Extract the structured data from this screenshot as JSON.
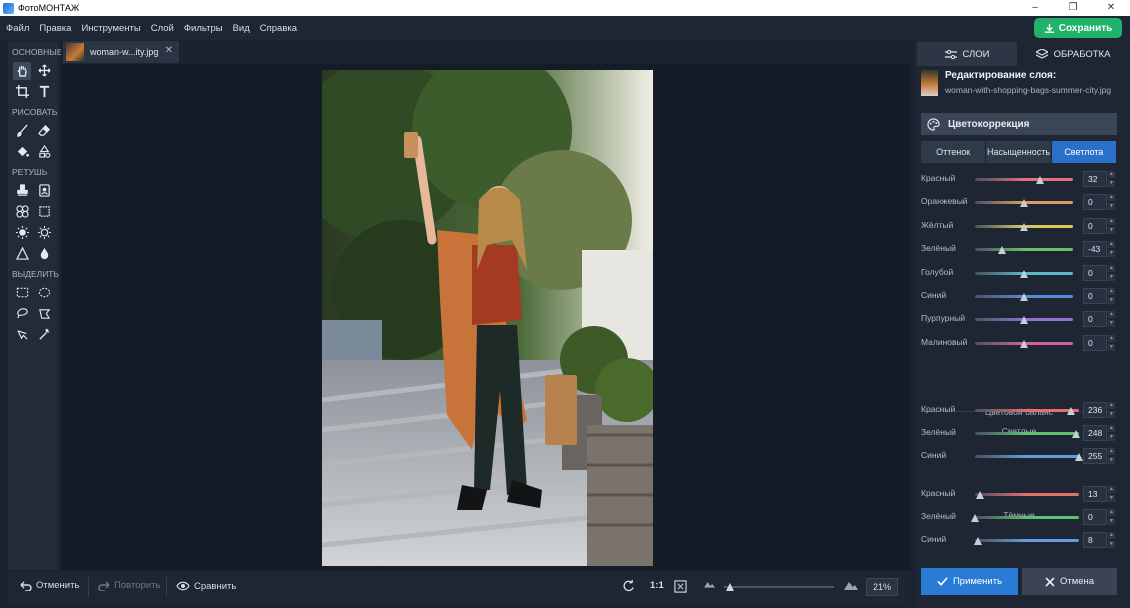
{
  "window": {
    "title": "ФотоМОНТАЖ"
  },
  "menu": [
    "Файл",
    "Правка",
    "Инструменты",
    "Слой",
    "Фильтры",
    "Вид",
    "Справка"
  ],
  "save_label": "Сохранить",
  "toolbox": {
    "basic": "ОСНОВНЫЕ",
    "draw": "РИСОВАТЬ",
    "retouch": "РЕТУШЬ",
    "select": "ВЫДЕЛИТЬ"
  },
  "document": {
    "tab_name": "woman-w...ity.jpg"
  },
  "bottom": {
    "undo": "Отменить",
    "redo": "Повторить",
    "compare": "Сравнить",
    "one_to_one": "1:1",
    "zoom": "21%",
    "zoom_level": 0.02
  },
  "panel": {
    "tabs": {
      "layers": "СЛОИ",
      "processing": "ОБРАБОТКА"
    },
    "edit_title": "Редактирование слоя:",
    "edit_file": "woman-with-shopping-bags-summer-city.jpg",
    "section": "Цветокоррекция",
    "subtabs": [
      "Оттенок",
      "Насыщенность",
      "Светлота"
    ],
    "active_subtab": 2,
    "sliders": [
      {
        "label": "Красный",
        "value": "32",
        "fraction": 0.66,
        "color": "#e0707a"
      },
      {
        "label": "Оранжевый",
        "value": "0",
        "fraction": 0.5,
        "color": "#e09a60"
      },
      {
        "label": "Жёлтый",
        "value": "0",
        "fraction": 0.5,
        "color": "#d8c860"
      },
      {
        "label": "Зелёный",
        "value": "-43",
        "fraction": 0.28,
        "color": "#6cc060"
      },
      {
        "label": "Голубой",
        "value": "0",
        "fraction": 0.5,
        "color": "#5ab8c8"
      },
      {
        "label": "Синий",
        "value": "0",
        "fraction": 0.5,
        "color": "#5a88d8"
      },
      {
        "label": "Пурпурный",
        "value": "0",
        "fraction": 0.5,
        "color": "#9070d0"
      },
      {
        "label": "Малиновый",
        "value": "0",
        "fraction": 0.5,
        "color": "#d060a0"
      }
    ],
    "color_balance": "Цветовой баланс",
    "light": "Светлые",
    "dark": "Тёмные",
    "light_sliders": [
      {
        "label": "Красный",
        "value": "236",
        "fraction": 0.925,
        "color": "#e07070"
      },
      {
        "label": "Зелёный",
        "value": "248",
        "fraction": 0.973,
        "color": "#60c070"
      },
      {
        "label": "Синий",
        "value": "255",
        "fraction": 1.0,
        "color": "#60a0e0"
      }
    ],
    "dark_sliders": [
      {
        "label": "Красный",
        "value": "13",
        "fraction": 0.051,
        "color": "#e07070"
      },
      {
        "label": "Зелёный",
        "value": "0",
        "fraction": 0.0,
        "color": "#60c070"
      },
      {
        "label": "Синий",
        "value": "8",
        "fraction": 0.031,
        "color": "#60a0e0"
      }
    ],
    "apply": "Применить",
    "cancel": "Отмена"
  }
}
